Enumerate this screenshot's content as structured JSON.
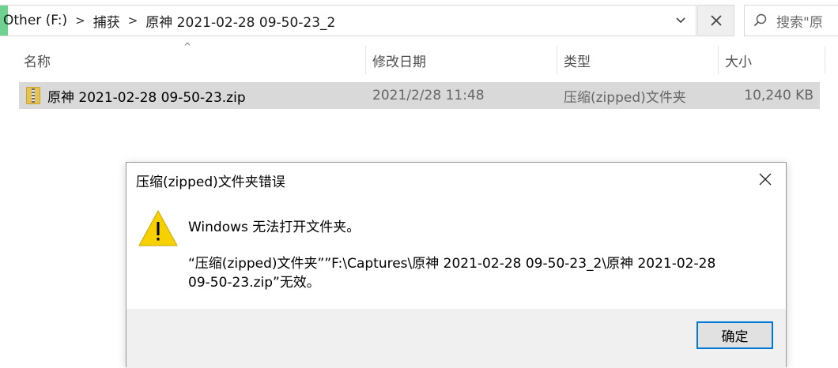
{
  "address_bar": {
    "crumbs": [
      "Other (F:)",
      "捕获",
      "原神 2021-02-28 09-50-23_2"
    ],
    "separator": ">",
    "dropdown_icon": "chevron-down-icon",
    "close_icon": "close-icon",
    "search_placeholder": "搜索\"原"
  },
  "columns": {
    "name": "名称",
    "date_modified": "修改日期",
    "type": "类型",
    "size": "大小",
    "sort_indicator": "^"
  },
  "files": [
    {
      "name": "原神 2021-02-28 09-50-23.zip",
      "date_modified": "2021/2/28 11:48",
      "type": "压缩(zipped)文件夹",
      "size": "10,240 KB",
      "icon": "zip-folder-icon"
    }
  ],
  "dialog": {
    "title": "压缩(zipped)文件夹错误",
    "icon": "warning-icon",
    "message_main": "Windows 无法打开文件夹。",
    "message_detail_line1": "“压缩(zipped)文件夹””F:\\Captures\\原神 2021-02-28 09-50-23_2\\原神 2021-02-28",
    "message_detail_line2": "09-50-23.zip”无效。",
    "ok_label": "确定"
  },
  "colors": {
    "drive_accent": "#6fd18f",
    "selected_row": "#d9d9d9",
    "button_focus_border": "#0078d7",
    "warning_fill": "#f7d000"
  }
}
